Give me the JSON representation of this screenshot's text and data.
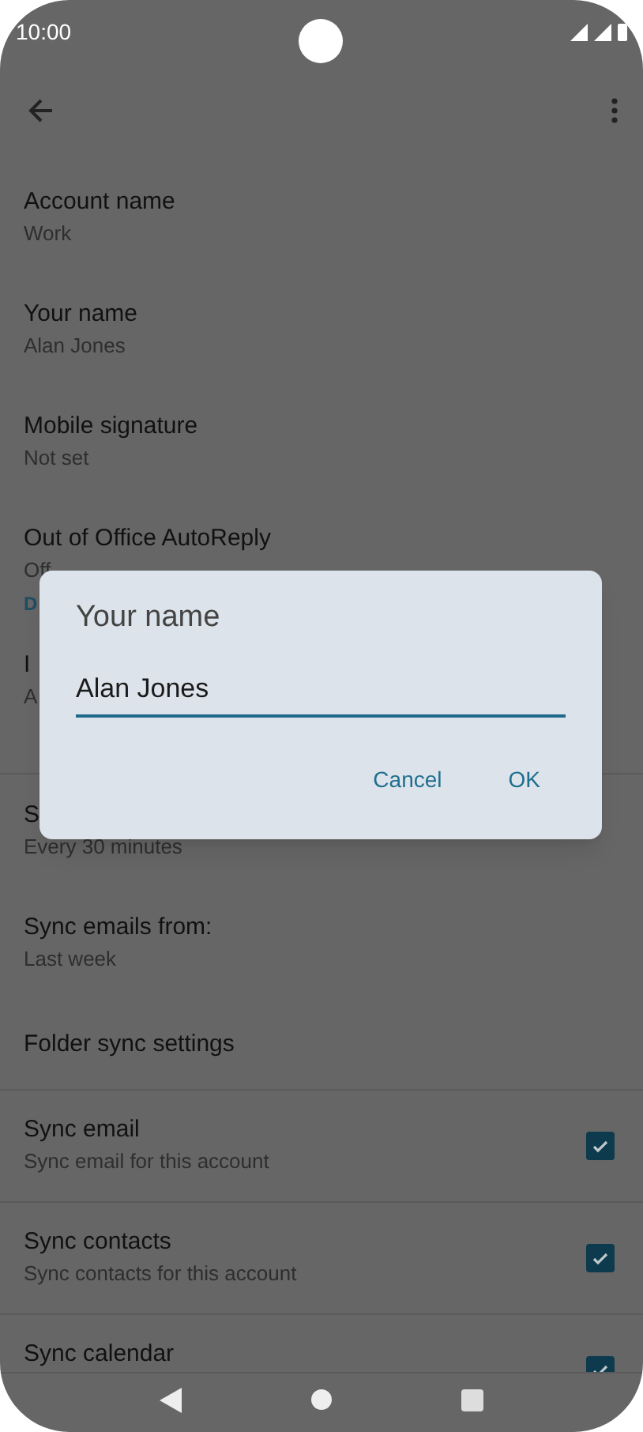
{
  "status_bar": {
    "time": "10:00"
  },
  "settings": [
    {
      "kind": "text",
      "title": "Account name",
      "subtitle": "Work"
    },
    {
      "kind": "text",
      "title": "Your name",
      "subtitle": "Alan Jones"
    },
    {
      "kind": "text",
      "title": "Mobile signature",
      "subtitle": "Not set"
    },
    {
      "kind": "text",
      "title": "Out of Office AutoReply",
      "subtitle": "Off"
    },
    {
      "kind": "header",
      "title": "D"
    },
    {
      "kind": "text",
      "title": "I",
      "subtitle": "A"
    },
    {
      "kind": "divider"
    },
    {
      "kind": "text",
      "title": "S",
      "subtitle": "Every 30 minutes"
    },
    {
      "kind": "text",
      "title": "Sync emails from:",
      "subtitle": "Last week"
    },
    {
      "kind": "text",
      "title": "Folder sync settings"
    },
    {
      "kind": "checkbox",
      "title": "Sync email",
      "subtitle": "Sync email for this account",
      "checked": true
    },
    {
      "kind": "checkbox",
      "title": "Sync contacts",
      "subtitle": "Sync contacts for this account",
      "checked": true
    },
    {
      "kind": "checkbox",
      "title": "Sync calendar",
      "checked": true
    }
  ],
  "dialog": {
    "title": "Your name",
    "value": "Alan Jones",
    "buttons": [
      "Cancel",
      "OK"
    ]
  }
}
